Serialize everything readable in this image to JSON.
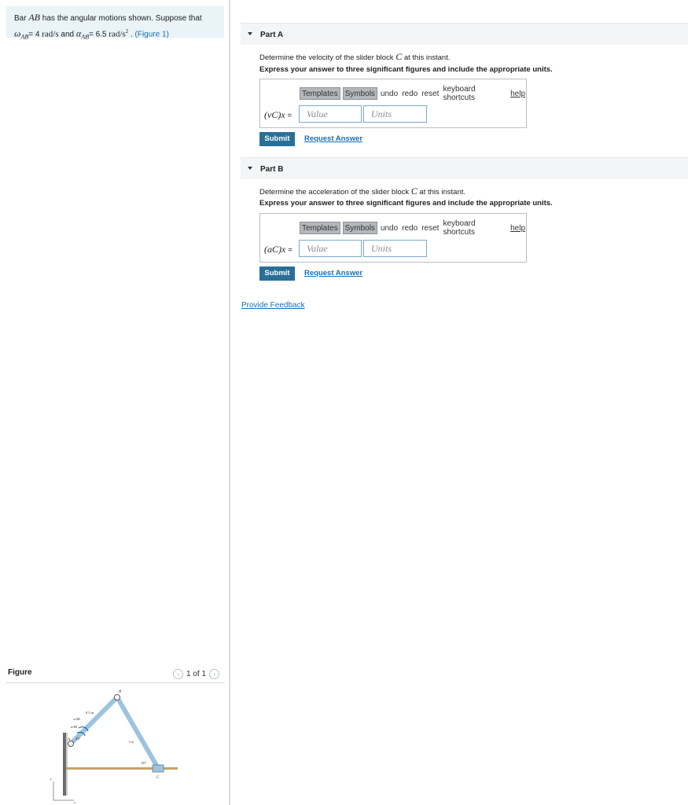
{
  "problem": {
    "text_prefix": "Bar ",
    "bar_name": "AB",
    "text_mid": " has the angular motions shown. Suppose that",
    "omega_symbol": "ω",
    "omega_sub": "AB",
    "omega_value": "= 4",
    "omega_unit": "rad/s",
    "and_text": " and ",
    "alpha_symbol": "α",
    "alpha_sub": "AB",
    "alpha_value": "= 6.5",
    "alpha_unit": "rad/s",
    "alpha_unit_exp": "2",
    "period": " . ",
    "figure_link": "(Figure 1)"
  },
  "figure": {
    "header": "Figure",
    "pager": "1 of 1",
    "prev_icon": "chevron-left-icon",
    "next_icon": "chevron-right-icon",
    "labels": {
      "B": "B",
      "A": "A",
      "C": "C",
      "len_ab": "0.5 m",
      "len_bc": "1 m",
      "omega": "ωAB",
      "alpha": "αAB",
      "angle_a": "45°",
      "angle_c": "60°",
      "axis_y": "y",
      "axis_x": "x"
    }
  },
  "parts": [
    {
      "title": "Part A",
      "prompt_prefix": "Determine the velocity of the slider block ",
      "prompt_var": "C",
      "prompt_suffix": " at this instant.",
      "instruction": "Express your answer to three significant figures and include the appropriate units.",
      "var_label": "(vC)x",
      "eq": " =",
      "value_placeholder": "Value",
      "units_placeholder": "Units",
      "submit": "Submit",
      "request": "Request Answer"
    },
    {
      "title": "Part B",
      "prompt_prefix": "Determine the acceleration of the slider block ",
      "prompt_var": "C",
      "prompt_suffix": " at this instant.",
      "instruction": "Express your answer to three significant figures and include the appropriate units.",
      "var_label": "(aC)x",
      "eq": " =",
      "value_placeholder": "Value",
      "units_placeholder": "Units",
      "submit": "Submit",
      "request": "Request Answer"
    }
  ],
  "toolbar": {
    "templates": "Templates",
    "symbols": "Symbols",
    "undo": "undo",
    "redo": "redo",
    "reset": "reset",
    "shortcuts": "keyboard shortcuts",
    "help": "help"
  },
  "feedback": "Provide Feedback",
  "colors": {
    "accent": "#2a6f97",
    "link": "#1a6fb0",
    "problem_bg": "#e9f3f8",
    "bar_fill": "#9ec4dd"
  }
}
